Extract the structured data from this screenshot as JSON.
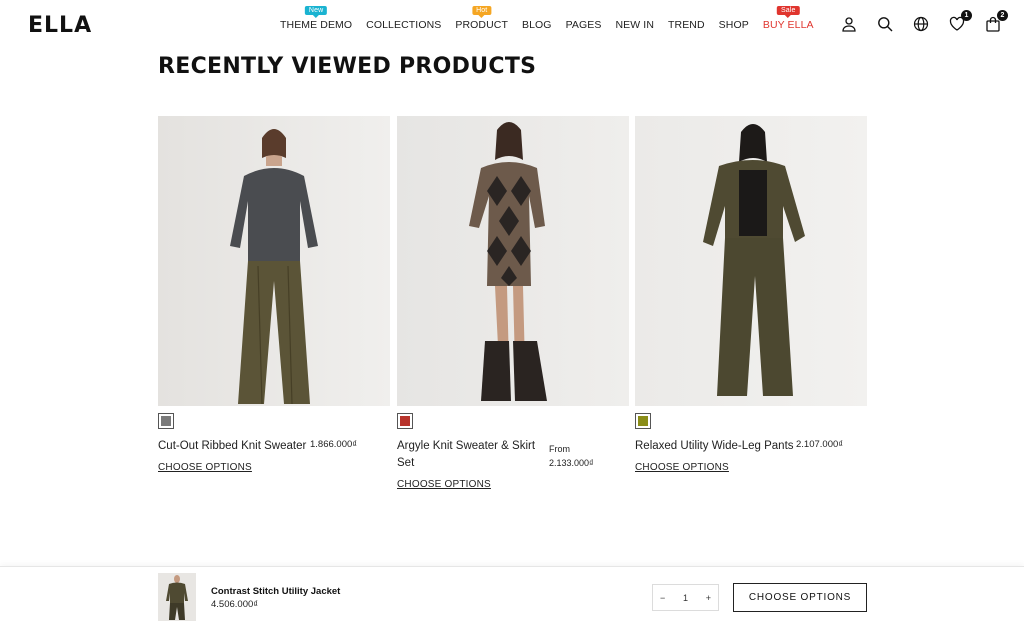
{
  "header": {
    "logo": "ELLA",
    "nav": [
      {
        "label": "THEME DEMO",
        "badge": "New",
        "badge_color": "#1ab3d1"
      },
      {
        "label": "COLLECTIONS"
      },
      {
        "label": "PRODUCT",
        "badge": "Hot",
        "badge_color": "#f5a623"
      },
      {
        "label": "BLOG"
      },
      {
        "label": "PAGES"
      },
      {
        "label": "NEW IN"
      },
      {
        "label": "TREND"
      },
      {
        "label": "SHOP"
      },
      {
        "label": "BUY ELLA",
        "badge": "Sale",
        "badge_color": "#e0352e",
        "red": true
      }
    ],
    "icons": [
      "account-icon",
      "search-icon",
      "globe-icon",
      "wishlist-heart-icon",
      "cart-bag-icon"
    ],
    "wishlist_count": "1",
    "cart_count": "2"
  },
  "section": {
    "title": "RECENTLY VIEWED PRODUCTS"
  },
  "products": [
    {
      "name": "Cut-Out Ribbed Knit Sweater",
      "price": "1.866.000₫",
      "swatch": "#7a7a7a",
      "cta": "CHOOSE OPTIONS"
    },
    {
      "name": "Argyle Knit Sweater & Skirt Set",
      "price_prefix": "From",
      "price": "2.133.000₫",
      "swatch": "#b8342c",
      "cta": "CHOOSE OPTIONS"
    },
    {
      "name": "Relaxed Utility Wide-Leg Pants",
      "price": "2.107.000₫",
      "swatch": "#8a8d18",
      "cta": "CHOOSE OPTIONS"
    }
  ],
  "sticky": {
    "name": "Contrast Stitch Utility Jacket",
    "price": "4.506.000₫",
    "qty_minus": "−",
    "qty": "1",
    "qty_plus": "+",
    "button": "CHOOSE OPTIONS"
  }
}
